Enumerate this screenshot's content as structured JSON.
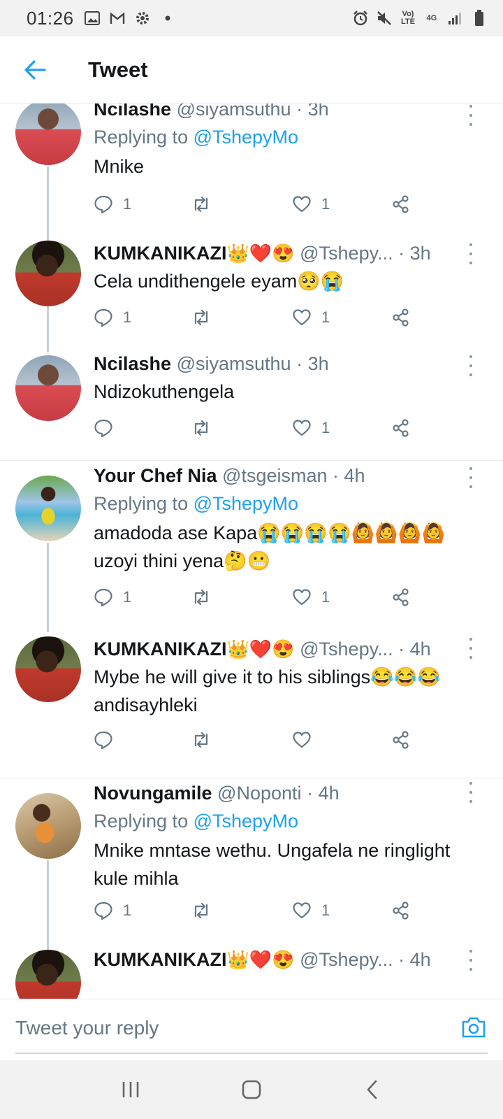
{
  "status_bar": {
    "time": "01:26",
    "left_icons": [
      "gallery-icon",
      "gmail-icon",
      "settings-icon",
      "notification-dot-icon"
    ],
    "right_icons": [
      "alarm-icon",
      "mute-icon",
      "volte-icon",
      "4g-icon",
      "signal-icon",
      "battery-icon"
    ],
    "volte": "Vo)\nLTE",
    "network": "4G"
  },
  "header": {
    "title": "Tweet"
  },
  "colors": {
    "accent": "#1da1f2",
    "muted": "#657786",
    "divider": "#e6ecf0"
  },
  "tweets": [
    {
      "name": "Ncilashe",
      "handle": "@siyamsuthu",
      "dot": "·",
      "time": "3h",
      "replying_prefix": "Replying to ",
      "replying_to": "@TshepyMo",
      "text": "Mnike",
      "reply_count": "1",
      "like_count": "1"
    },
    {
      "name": "KUMKANIKAZI",
      "name_emoji": "👑❤️😍",
      "handle": "@Tshepy...",
      "dot": "·",
      "time": "3h",
      "text": "Cela undithengele eyam🥺😭",
      "reply_count": "1",
      "like_count": "1"
    },
    {
      "name": "Ncilashe",
      "handle": "@siyamsuthu",
      "dot": "·",
      "time": "3h",
      "text": "Ndizokuthengela",
      "reply_count": "",
      "like_count": "1"
    },
    {
      "name": "Your Chef Nia",
      "handle": "@tsgeisman",
      "dot": "·",
      "time": "4h",
      "replying_prefix": "Replying to ",
      "replying_to": "@TshepyMo",
      "text": "amadoda ase Kapa😭😭😭😭🙆🙆🙆🙆 uzoyi thini yena🤔😬",
      "reply_count": "1",
      "like_count": "1"
    },
    {
      "name": "KUMKANIKAZI",
      "name_emoji": "👑❤️😍",
      "handle": "@Tshepy...",
      "dot": "·",
      "time": "4h",
      "text": "Mybe he will give it to his siblings😂😂😂 andisayhleki",
      "reply_count": "",
      "like_count": ""
    },
    {
      "name": "Novungamile",
      "handle": "@Noponti",
      "dot": "·",
      "time": "4h",
      "replying_prefix": "Replying to ",
      "replying_to": "@TshepyMo",
      "text": "Mnike mntase wethu. Ungafela ne ringlight kule mihla",
      "reply_count": "1",
      "like_count": "1"
    },
    {
      "name": "KUMKANIKAZI",
      "name_emoji": "👑❤️😍",
      "handle": "@Tshepy...",
      "dot": "·",
      "time": "4h"
    }
  ],
  "reply_bar": {
    "placeholder": "Tweet your reply"
  },
  "nav": {
    "buttons": [
      "recent-apps-icon",
      "home-icon",
      "back-icon"
    ]
  }
}
